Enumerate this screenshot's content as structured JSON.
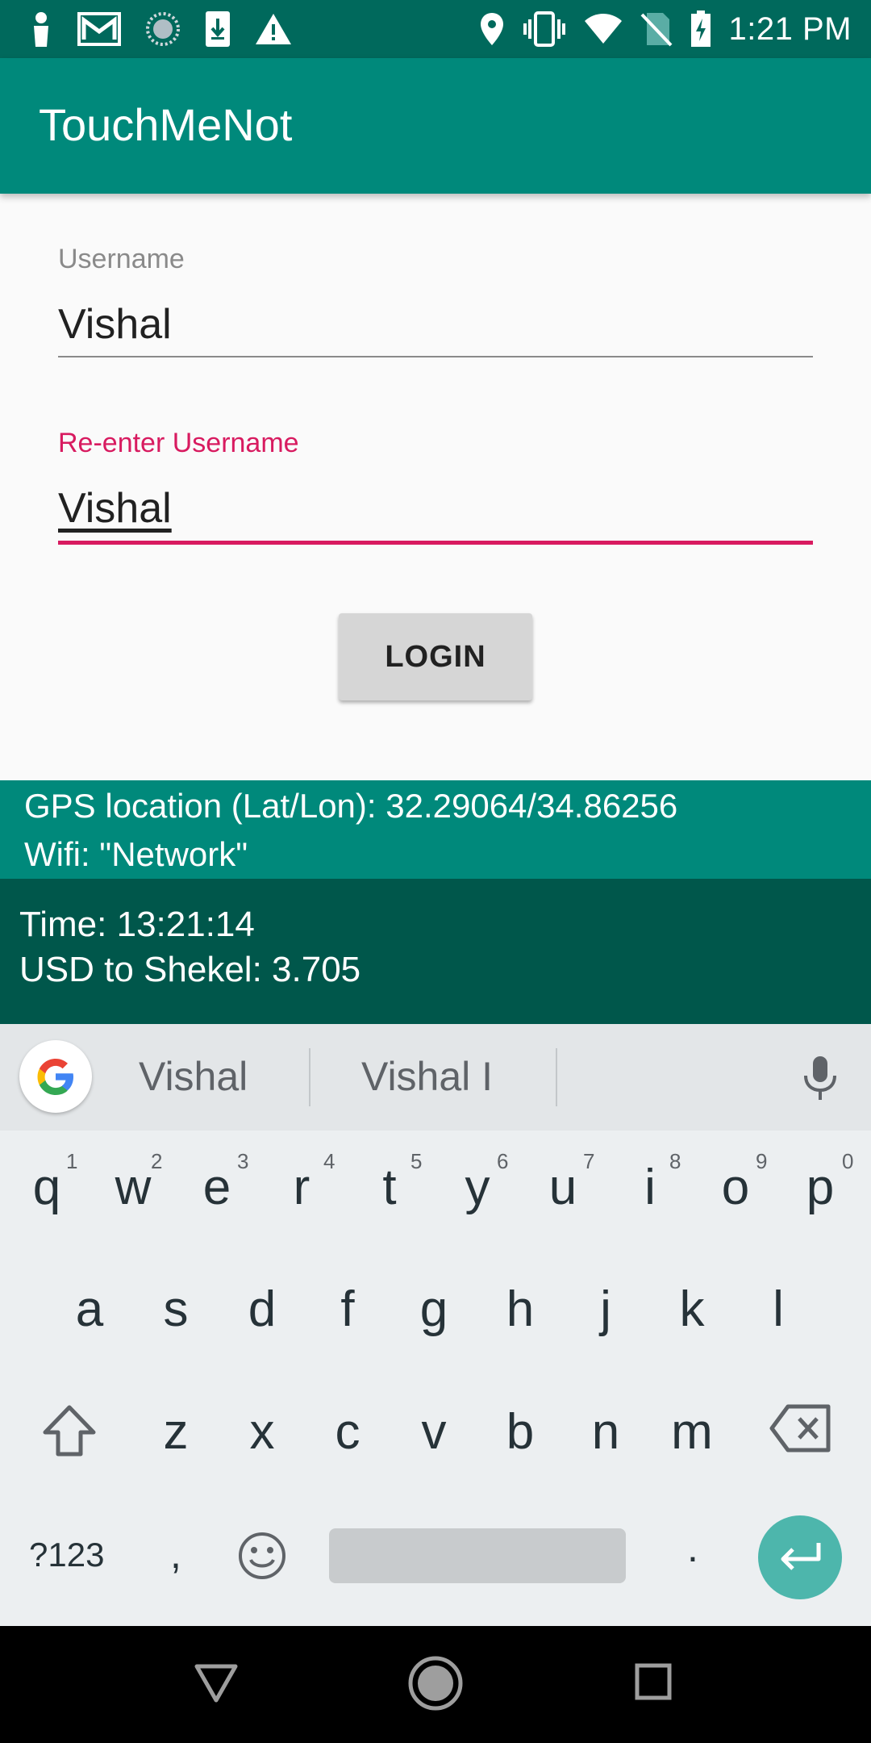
{
  "status_bar": {
    "time": "1:21 PM",
    "left_icons": [
      "person-icon",
      "gmail-icon",
      "sync-icon",
      "download-icon",
      "warning-icon"
    ],
    "right_icons": [
      "location-icon",
      "vibrate-icon",
      "wifi-icon",
      "no-sim-icon",
      "battery-charging-icon"
    ]
  },
  "app_bar": {
    "title": "TouchMeNot"
  },
  "form": {
    "username_label": "Username",
    "username_value": "Vishal",
    "reenter_label": "Re-enter Username",
    "reenter_value": "Vishal",
    "login_label": "LOGIN"
  },
  "info": {
    "gps": "GPS location (Lat/Lon): 32.29064/34.86256",
    "wifi": "Wifi: \"Network\"",
    "time": "Time: 13:21:14",
    "currency": "USD to Shekel: 3.705"
  },
  "keyboard": {
    "suggestions": [
      "Vishal",
      "Vishal I"
    ],
    "row1": [
      "q",
      "w",
      "e",
      "r",
      "t",
      "y",
      "u",
      "i",
      "o",
      "p"
    ],
    "row1_hints": [
      "1",
      "2",
      "3",
      "4",
      "5",
      "6",
      "7",
      "8",
      "9",
      "0"
    ],
    "row2": [
      "a",
      "s",
      "d",
      "f",
      "g",
      "h",
      "j",
      "k",
      "l"
    ],
    "row3": [
      "z",
      "x",
      "c",
      "v",
      "b",
      "n",
      "m"
    ],
    "symbols_label": "?123",
    "comma_label": ",",
    "period_label": "."
  },
  "colors": {
    "primary": "#00897b",
    "primary_dark": "#00695c",
    "accent": "#d81b60"
  }
}
